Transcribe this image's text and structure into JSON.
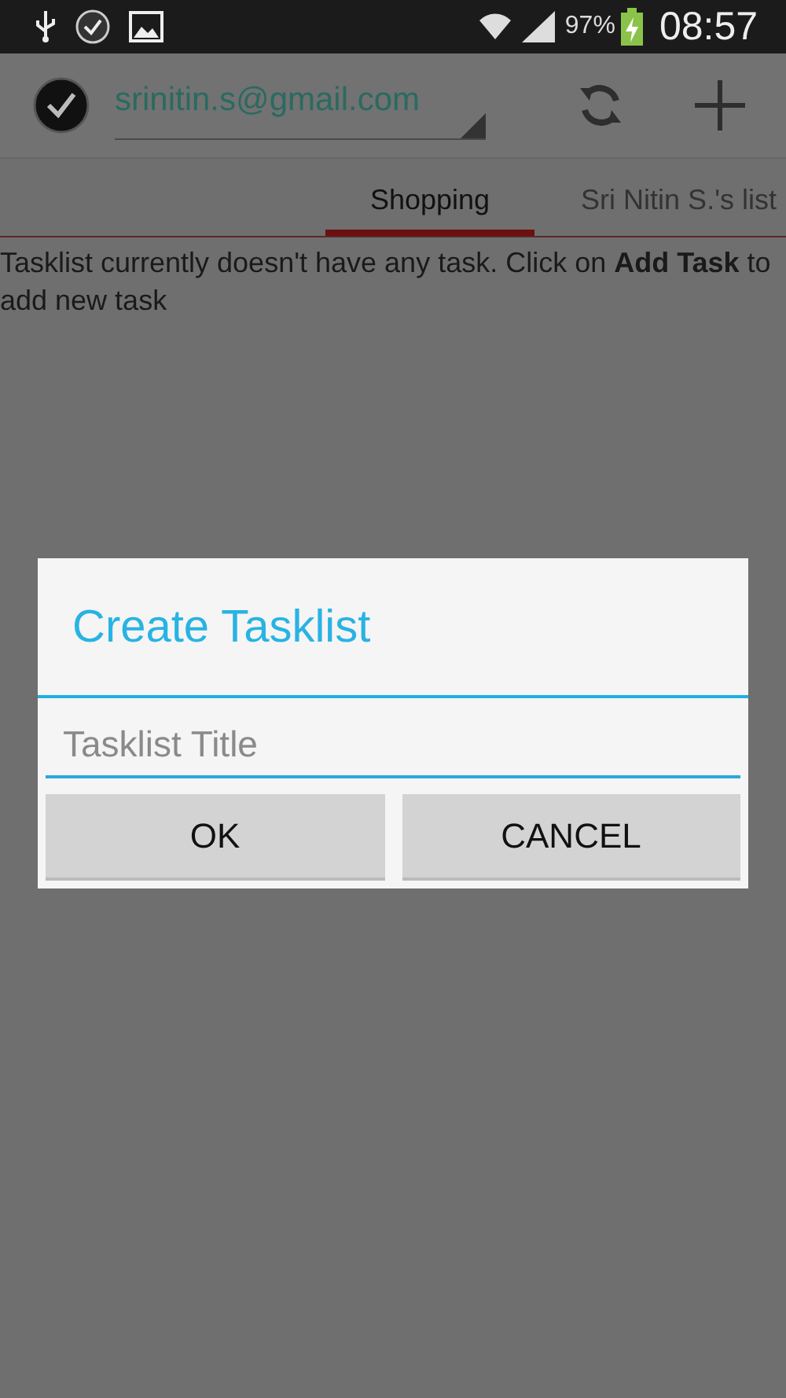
{
  "status_bar": {
    "battery": "97%",
    "time": "08:57"
  },
  "action_bar": {
    "account": "srinitin.s@gmail.com"
  },
  "tabs": [
    {
      "label": "Shopping",
      "selected": true
    },
    {
      "label": "Sri Nitin S.'s list",
      "selected": false
    }
  ],
  "message": "Tasklist currently doesn't have any task. Click on **Add Task** to add new task",
  "dialog": {
    "title": "Create Tasklist",
    "field": {
      "placeholder": "Tasklist Title"
    },
    "buttons": [
      {
        "label": "OK"
      },
      {
        "label": "CANCEL"
      }
    ]
  }
}
